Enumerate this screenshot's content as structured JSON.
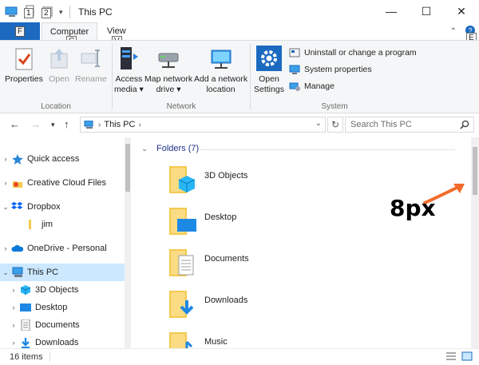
{
  "window": {
    "title": "This PC",
    "qat_keytips": [
      "1",
      "2"
    ],
    "controls": {
      "minimize": "—",
      "maximize": "☐",
      "close": "✕"
    }
  },
  "ribbon_tabs": {
    "file": {
      "label": "",
      "keytip": "F"
    },
    "computer": {
      "label": "Computer",
      "keytip": "C"
    },
    "view": {
      "label": "View",
      "keytip": "V"
    },
    "help_keytip": "E"
  },
  "ribbon": {
    "location": {
      "label": "Location",
      "properties": "Properties",
      "open": "Open",
      "rename": "Rename"
    },
    "network": {
      "label": "Network",
      "access_media": "Access\nmedia ▾",
      "map_drive": "Map network\ndrive ▾",
      "add_location": "Add a network\nlocation"
    },
    "system": {
      "label": "System",
      "open_settings": "Open\nSettings",
      "uninstall": "Uninstall or change a program",
      "system_properties": "System properties",
      "manage": "Manage"
    }
  },
  "address_bar": {
    "path": "This PC",
    "search_placeholder": "Search This PC"
  },
  "nav_pane": {
    "items": [
      {
        "label": "Quick access",
        "icon": "star-icon",
        "expanded": false
      },
      {
        "label": "Creative Cloud Files",
        "icon": "creative-cloud-icon",
        "expanded": false
      },
      {
        "label": "Dropbox",
        "icon": "dropbox-icon",
        "expanded": true
      },
      {
        "label": "jim",
        "icon": "folder-icon",
        "expanded": null
      },
      {
        "label": "OneDrive - Personal",
        "icon": "onedrive-icon",
        "expanded": false
      },
      {
        "label": "This PC",
        "icon": "pc-icon",
        "expanded": true,
        "selected": true
      },
      {
        "label": "3D Objects",
        "icon": "3d-objects-icon",
        "expanded": false
      },
      {
        "label": "Desktop",
        "icon": "desktop-icon",
        "expanded": false
      },
      {
        "label": "Documents",
        "icon": "documents-icon",
        "expanded": false
      },
      {
        "label": "Downloads",
        "icon": "downloads-icon",
        "expanded": false
      }
    ]
  },
  "content": {
    "group_header": "Folders (7)",
    "folders": [
      "3D Objects",
      "Desktop",
      "Documents",
      "Downloads",
      "Music"
    ]
  },
  "annotation": {
    "text": "8px",
    "color": "#f26b2a"
  },
  "status": {
    "count": "16 items"
  },
  "colors": {
    "accent": "#1b6ac0",
    "selection": "#cce8ff",
    "folder": "#f4c94e"
  }
}
